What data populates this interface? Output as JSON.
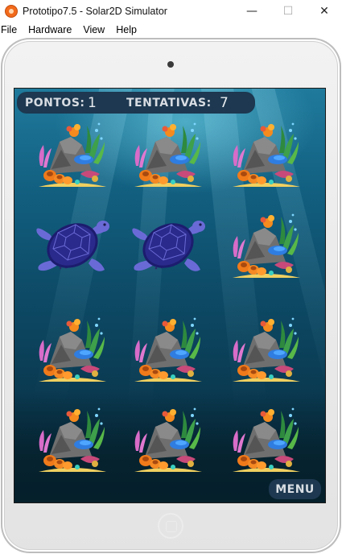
{
  "window": {
    "title": "Prototipo7.5 - Solar2D Simulator",
    "minimize_glyph": "—",
    "maximize_glyph": "☐",
    "close_glyph": "✕"
  },
  "menubar": {
    "items": [
      "File",
      "Hardware",
      "View",
      "Help"
    ]
  },
  "hud": {
    "score_label": "PONTOS:",
    "score_value": "1",
    "attempts_label": "TENTATIVAS:",
    "attempts_value": "7"
  },
  "board": {
    "rows": 4,
    "cols": 3,
    "cards": [
      {
        "face": "reef",
        "revealed": false
      },
      {
        "face": "reef",
        "revealed": false
      },
      {
        "face": "reef",
        "revealed": false
      },
      {
        "face": "turtle",
        "revealed": true
      },
      {
        "face": "turtle",
        "revealed": true
      },
      {
        "face": "reef",
        "revealed": false
      },
      {
        "face": "reef",
        "revealed": false
      },
      {
        "face": "reef",
        "revealed": false
      },
      {
        "face": "reef",
        "revealed": false
      },
      {
        "face": "reef",
        "revealed": false
      },
      {
        "face": "reef",
        "revealed": false
      },
      {
        "face": "reef",
        "revealed": false
      }
    ]
  },
  "menu_button": {
    "label": "MENU"
  },
  "colors": {
    "hud_bg": "#1d3850",
    "hud_text": "#d8dde3",
    "ocean_top": "#1f7a9c",
    "ocean_bottom": "#062636",
    "turtle": "#2a2a8c",
    "turtle_flipper": "#6a6ad6",
    "app_icon": "#f26a1b"
  }
}
